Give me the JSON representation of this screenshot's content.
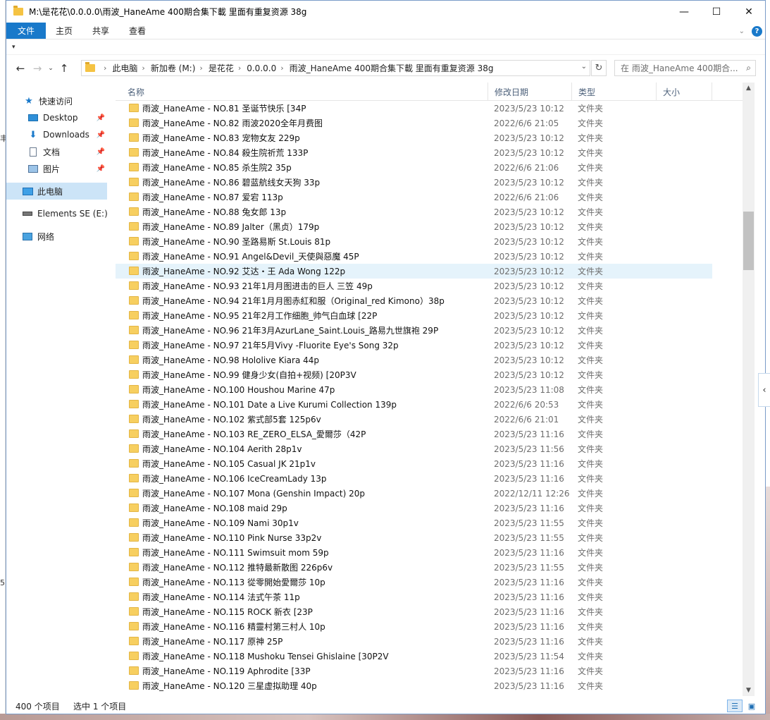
{
  "window": {
    "title": "M:\\是花花\\0.0.0.0\\雨波_HaneAme 400期合集下載 里面有重复资源 38g",
    "minimize": "—",
    "maximize": "☐",
    "close": "✕"
  },
  "ribbon": {
    "tabs": [
      "文件",
      "主页",
      "共享",
      "查看"
    ]
  },
  "address": {
    "crumbs": [
      "此电脑",
      "新加卷 (M:)",
      "是花花",
      "0.0.0.0",
      "雨波_HaneAme 400期合集下載 里面有重复资源 38g"
    ]
  },
  "search": {
    "placeholder": "在 雨波_HaneAme 400期合..."
  },
  "nav": {
    "quick_access": "快速访问",
    "desktop": "Desktop",
    "downloads": "Downloads",
    "documents": "文档",
    "pictures": "图片",
    "this_pc": "此电脑",
    "drive": "Elements SE (E:)",
    "network": "网络"
  },
  "columns": {
    "name": "名称",
    "date": "修改日期",
    "type": "类型",
    "size": "大小"
  },
  "files": [
    {
      "name": "雨波_HaneAme - NO.81 圣诞节快乐 [34P",
      "date": "2023/5/23 10:12",
      "type": "文件夹"
    },
    {
      "name": "雨波_HaneAme - NO.82 雨波2020全年月费图",
      "date": "2022/6/6 21:05",
      "type": "文件夹"
    },
    {
      "name": "雨波_HaneAme - NO.83 宠物女友 229p",
      "date": "2023/5/23 10:12",
      "type": "文件夹"
    },
    {
      "name": "雨波_HaneAme - NO.84 殺生院祈荒 133P",
      "date": "2023/5/23 10:12",
      "type": "文件夹"
    },
    {
      "name": "雨波_HaneAme - NO.85 杀生院2 35p",
      "date": "2022/6/6 21:06",
      "type": "文件夹"
    },
    {
      "name": "雨波_HaneAme - NO.86 碧蓝航线女天狗 33p",
      "date": "2023/5/23 10:12",
      "type": "文件夹"
    },
    {
      "name": "雨波_HaneAme - NO.87 爱宕 113p",
      "date": "2022/6/6 21:06",
      "type": "文件夹"
    },
    {
      "name": "雨波_HaneAme - NO.88 兔女郎 13p",
      "date": "2023/5/23 10:12",
      "type": "文件夹"
    },
    {
      "name": "雨波_HaneAme - NO.89 Jalter（黑贞）179p",
      "date": "2023/5/23 10:12",
      "type": "文件夹"
    },
    {
      "name": "雨波_HaneAme - NO.90 圣路易斯 St.Louis 81p",
      "date": "2023/5/23 10:12",
      "type": "文件夹"
    },
    {
      "name": "雨波_HaneAme - NO.91 Angel&Devil_天使與惡魔 45P",
      "date": "2023/5/23 10:12",
      "type": "文件夹"
    },
    {
      "name": "雨波_HaneAme - NO.92 艾达・王 Ada Wong 122p",
      "date": "2023/5/23 10:12",
      "type": "文件夹",
      "selected": true
    },
    {
      "name": "雨波_HaneAme - NO.93 21年1月月图进击的巨人 三笠 49p",
      "date": "2023/5/23 10:12",
      "type": "文件夹"
    },
    {
      "name": "雨波_HaneAme - NO.94 21年1月月图赤紅和服（Original_red Kimono）38p",
      "date": "2023/5/23 10:12",
      "type": "文件夹"
    },
    {
      "name": "雨波_HaneAme - NO.95 21年2月工作细胞_帅气白血球 [22P",
      "date": "2023/5/23 10:12",
      "type": "文件夹"
    },
    {
      "name": "雨波_HaneAme - NO.96 21年3月AzurLane_Saint.Louis_路易九世旗袍 29P",
      "date": "2023/5/23 10:12",
      "type": "文件夹"
    },
    {
      "name": "雨波_HaneAme - NO.97 21年5月Vivy -Fluorite Eye's Song 32p",
      "date": "2023/5/23 10:12",
      "type": "文件夹"
    },
    {
      "name": "雨波_HaneAme - NO.98 Hololive Kiara 44p",
      "date": "2023/5/23 10:12",
      "type": "文件夹"
    },
    {
      "name": "雨波_HaneAme - NO.99 健身少女(自拍+视频) [20P3V",
      "date": "2023/5/23 10:12",
      "type": "文件夹"
    },
    {
      "name": "雨波_HaneAme - NO.100 Houshou Marine 47p",
      "date": "2023/5/23 11:08",
      "type": "文件夹"
    },
    {
      "name": "雨波_HaneAme - NO.101 Date a Live Kurumi Collection 139p",
      "date": "2022/6/6 20:53",
      "type": "文件夹"
    },
    {
      "name": "雨波_HaneAme - NO.102 紫式部5套 125p6v",
      "date": "2022/6/6 21:01",
      "type": "文件夹"
    },
    {
      "name": "雨波_HaneAme - NO.103 RE_ZERO_ELSA_愛爾莎（42P",
      "date": "2023/5/23 11:16",
      "type": "文件夹"
    },
    {
      "name": "雨波_HaneAme - NO.104 Aerith 28p1v",
      "date": "2023/5/23 11:56",
      "type": "文件夹"
    },
    {
      "name": "雨波_HaneAme - NO.105 Casual JK 21p1v",
      "date": "2023/5/23 11:16",
      "type": "文件夹"
    },
    {
      "name": "雨波_HaneAme - NO.106 IceCreamLady 13p",
      "date": "2023/5/23 11:16",
      "type": "文件夹"
    },
    {
      "name": "雨波_HaneAme - NO.107 Mona (Genshin Impact) 20p",
      "date": "2022/12/11 12:26",
      "type": "文件夹"
    },
    {
      "name": "雨波_HaneAme - NO.108 maid 29p",
      "date": "2023/5/23 11:16",
      "type": "文件夹"
    },
    {
      "name": "雨波_HaneAme - NO.109 Nami 30p1v",
      "date": "2023/5/23 11:55",
      "type": "文件夹"
    },
    {
      "name": "雨波_HaneAme - NO.110 Pink Nurse 33p2v",
      "date": "2023/5/23 11:55",
      "type": "文件夹"
    },
    {
      "name": "雨波_HaneAme - NO.111 Swimsuit mom 59p",
      "date": "2023/5/23 11:16",
      "type": "文件夹"
    },
    {
      "name": "雨波_HaneAme - NO.112 推特最新散图 226p6v",
      "date": "2023/5/23 11:55",
      "type": "文件夹"
    },
    {
      "name": "雨波_HaneAme - NO.113 從零開始愛爾莎 10p",
      "date": "2023/5/23 11:16",
      "type": "文件夹"
    },
    {
      "name": "雨波_HaneAme - NO.114 法式午茶 11p",
      "date": "2023/5/23 11:16",
      "type": "文件夹"
    },
    {
      "name": "雨波_HaneAme - NO.115 ROCK 新衣 [23P",
      "date": "2023/5/23 11:16",
      "type": "文件夹"
    },
    {
      "name": "雨波_HaneAme - NO.116 精靈村第三村人 10p",
      "date": "2023/5/23 11:16",
      "type": "文件夹"
    },
    {
      "name": "雨波_HaneAme - NO.117 原神 25P",
      "date": "2023/5/23 11:16",
      "type": "文件夹"
    },
    {
      "name": "雨波_HaneAme - NO.118 Mushoku Tensei Ghislaine [30P2V",
      "date": "2023/5/23 11:54",
      "type": "文件夹"
    },
    {
      "name": "雨波_HaneAme - NO.119 Aphrodite [33P",
      "date": "2023/5/23 11:16",
      "type": "文件夹"
    },
    {
      "name": "雨波_HaneAme - NO.120 三星虚拟助理 40p",
      "date": "2023/5/23 11:16",
      "type": "文件夹"
    }
  ],
  "status": {
    "count": "400 个项目",
    "selected": "选中 1 个项目"
  },
  "colors": {
    "accent": "#1979ca",
    "selection": "#e5f3fb",
    "nav_selected": "#cce4f7"
  }
}
